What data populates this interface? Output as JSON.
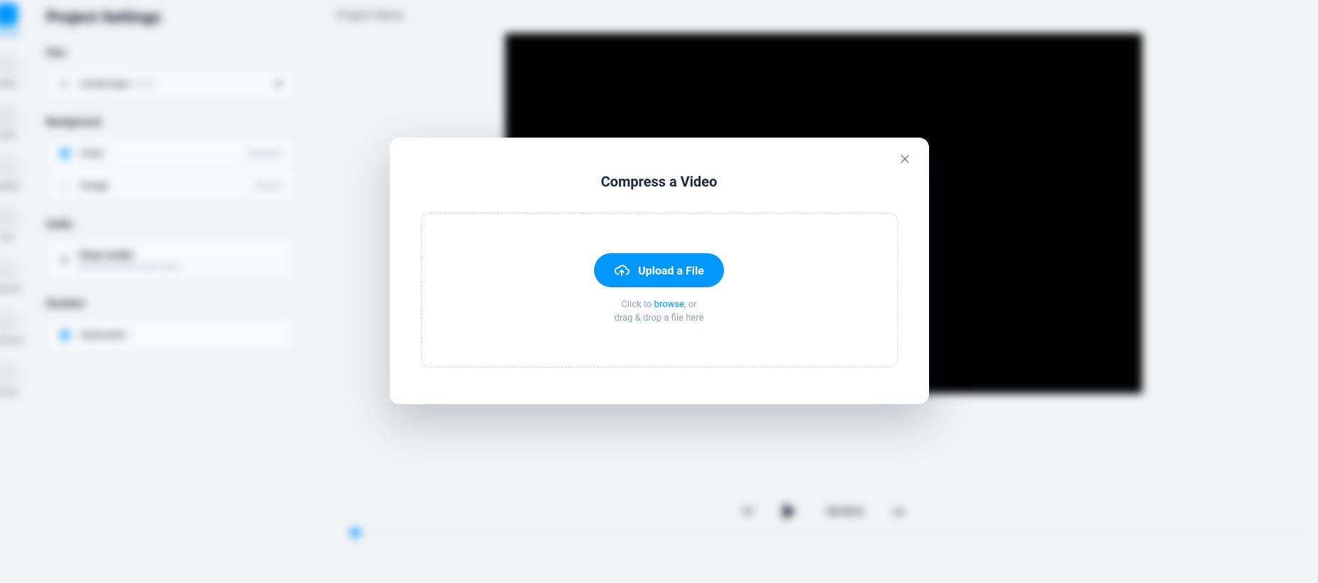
{
  "rail": {
    "items": [
      {
        "label": "Settings"
      },
      {
        "label": "Media"
      },
      {
        "label": "Audio"
      },
      {
        "label": "Subtitles"
      },
      {
        "label": "Text"
      },
      {
        "label": "Elements"
      },
      {
        "label": "Templates"
      },
      {
        "label": "Record"
      }
    ]
  },
  "settings": {
    "title": "Project Settings",
    "sizeLabel": "Size",
    "sizeValue": "Landscape",
    "sizeRatio": "(16:9)",
    "backgroundLabel": "Background",
    "bgColorLabel": "Color",
    "bgColorValue": "#000000",
    "bgImageLabel": "Image",
    "bgImageAction": "Upload",
    "audioLabel": "Audio",
    "cleanAudioTitle": "Clean Audio",
    "cleanAudioSub": "Remove background noise",
    "durationLabel": "Duration",
    "durationValue": "Automatic"
  },
  "main": {
    "projectName": "Project Name",
    "timecode": "00:00:0"
  },
  "modal": {
    "title": "Compress a Video",
    "uploadLabel": "Upload a File",
    "helpPrefix": "Click to ",
    "helpLink": "browse",
    "helpSuffix": ", or",
    "helpLine2": "drag & drop a file here"
  }
}
